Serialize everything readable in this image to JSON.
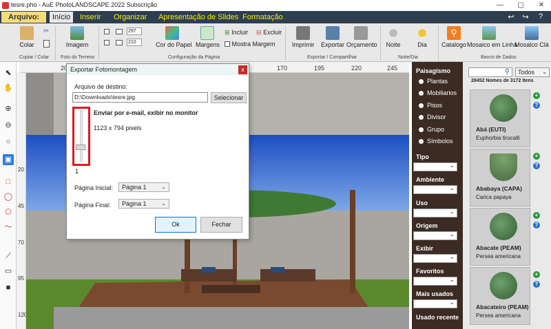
{
  "window": {
    "title": "tesre.pho - AuE PhotoLANDSCAPE 2022 Subscrição",
    "controls": {
      "minimize": "—",
      "maximize": "▢",
      "close": "✕"
    }
  },
  "menu": {
    "file_label": "Arquivo:",
    "tabs": [
      "Início",
      "Inserir",
      "Organizar",
      "Apresentação de Slides",
      "Formatação"
    ],
    "active_tab": "Início",
    "quick_access": [
      "↩",
      "↪",
      "?"
    ]
  },
  "ribbon": {
    "colar": "Colar",
    "imagem": "Imagem",
    "width_value": "297",
    "height_value": "210",
    "cor_do_papel": "Cor do Papel",
    "margens": "Margens",
    "incluir": "Incluir",
    "excluir": "Excluir",
    "mostra_margem": "Mostra Margem",
    "imprimir": "Imprimir",
    "exportar": "Exportar",
    "orcamento": "Orçamento",
    "noite": "Noite",
    "dia": "Dia",
    "catalogo": "Catalogo",
    "mosaico_em_linha": "Mosaico em Linha",
    "mosaico_cla": "Mosaico Clá",
    "groups": {
      "copiar_colar": "Copiar / Colar",
      "foto_terreno": "Foto do Terreno",
      "config_pagina": "Configuração da Página",
      "exportar_compartilhar": "Exportar / Compartilhar",
      "noite_dia": "Noite/Dia",
      "banco_dados": "Banco de Dados"
    }
  },
  "ruler": {
    "top": [
      "20",
      "170",
      "195",
      "220",
      "245"
    ],
    "left": [
      "20",
      "45",
      "70",
      "95",
      "120"
    ]
  },
  "dialog": {
    "title": "Exportar Fotomontagem",
    "close": "x",
    "dest_label": "Arquivo de destino:",
    "dest_value": "D:\\Downloads\\tesre.jpg",
    "select_button": "Selecionar",
    "email_label": "Enviar por e-mail, exibir no monitor",
    "size_label": "1123 x 794 pixels",
    "slider_value": "1",
    "slider_level": 0.25,
    "start_page_label": "Página Inicial:",
    "start_page_value": "Página 1",
    "end_page_label": "Página Final:",
    "end_page_value": "Página 1",
    "ok": "Ok",
    "close_button": "Fechar"
  },
  "side_panel": {
    "heading": "Paisagismo",
    "radios": [
      "Plantas",
      "Mobiliarios",
      "Pisos",
      "Divisor",
      "Grupo",
      "Símbolos"
    ],
    "selected_radio": "Plantas",
    "filters": [
      "Tipo",
      "Ambiente",
      "Uso",
      "Origem",
      "Exibir",
      "Favoritos",
      "Mais usados",
      "Usado recente"
    ]
  },
  "plant_panel": {
    "search_placeholder": "",
    "dropdown_value": "Todos",
    "count_text": "28452 Nomes de 3172 Itens",
    "items": [
      {
        "name": "Abá (EUTI)",
        "scientific": "Euphorbia tirucalli"
      },
      {
        "name": "Ababaya (CAPA)",
        "scientific": "Carica papaya"
      },
      {
        "name": "Abacate (PEAM)",
        "scientific": "Persea americana"
      },
      {
        "name": "Abacateiro (PEAM)",
        "scientific": "Persea americana"
      }
    ],
    "add_symbol": "+",
    "info_symbol": "?"
  },
  "colors": {
    "menubar": "#2d3e50",
    "menutext": "#ffeb00",
    "side_panel": "#3b2b22",
    "highlight": "#e0191f",
    "catalog_icon": "#f37d1e"
  }
}
